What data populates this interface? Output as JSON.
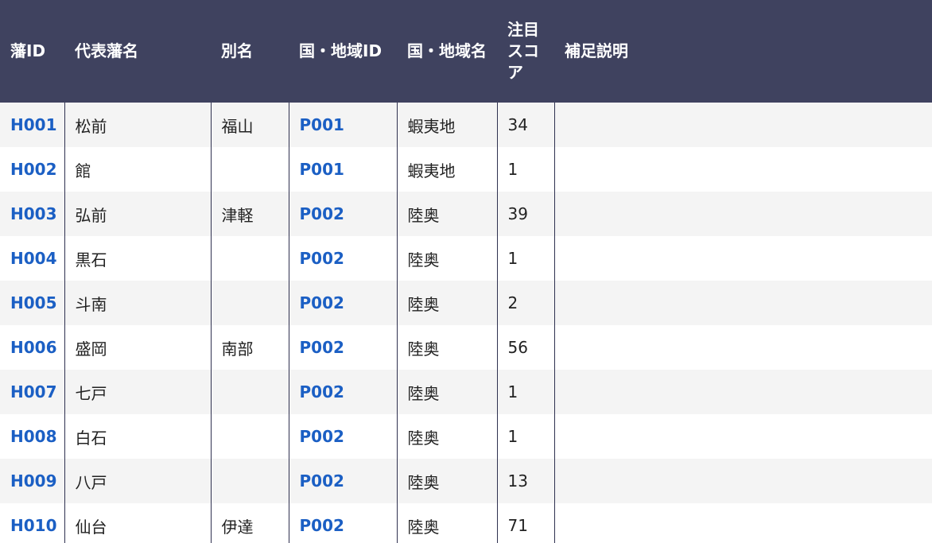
{
  "table": {
    "headers": {
      "han_id": "藩ID",
      "name": "代表藩名",
      "alias": "別名",
      "province_id": "国・地域ID",
      "province_name": "国・地域名",
      "score": "注目スコア",
      "note": "補足説明"
    },
    "rows": [
      {
        "han_id": "H001",
        "name": "松前",
        "alias": "福山",
        "province_id": "P001",
        "province_name": "蝦夷地",
        "score": "34",
        "note": ""
      },
      {
        "han_id": "H002",
        "name": "館",
        "alias": "",
        "province_id": "P001",
        "province_name": "蝦夷地",
        "score": "1",
        "note": ""
      },
      {
        "han_id": "H003",
        "name": "弘前",
        "alias": "津軽",
        "province_id": "P002",
        "province_name": "陸奥",
        "score": "39",
        "note": ""
      },
      {
        "han_id": "H004",
        "name": "黒石",
        "alias": "",
        "province_id": "P002",
        "province_name": "陸奥",
        "score": "1",
        "note": ""
      },
      {
        "han_id": "H005",
        "name": "斗南",
        "alias": "",
        "province_id": "P002",
        "province_name": "陸奥",
        "score": "2",
        "note": ""
      },
      {
        "han_id": "H006",
        "name": "盛岡",
        "alias": "南部",
        "province_id": "P002",
        "province_name": "陸奥",
        "score": "56",
        "note": ""
      },
      {
        "han_id": "H007",
        "name": "七戸",
        "alias": "",
        "province_id": "P002",
        "province_name": "陸奥",
        "score": "1",
        "note": ""
      },
      {
        "han_id": "H008",
        "name": "白石",
        "alias": "",
        "province_id": "P002",
        "province_name": "陸奥",
        "score": "1",
        "note": ""
      },
      {
        "han_id": "H009",
        "name": "八戸",
        "alias": "",
        "province_id": "P002",
        "province_name": "陸奥",
        "score": "13",
        "note": ""
      },
      {
        "han_id": "H010",
        "name": "仙台",
        "alias": "伊達",
        "province_id": "P002",
        "province_name": "陸奥",
        "score": "71",
        "note": ""
      }
    ]
  },
  "colors": {
    "header_bg": "#3f425f",
    "link": "#1b5fc4",
    "row_alt": "#f4f4f4"
  }
}
